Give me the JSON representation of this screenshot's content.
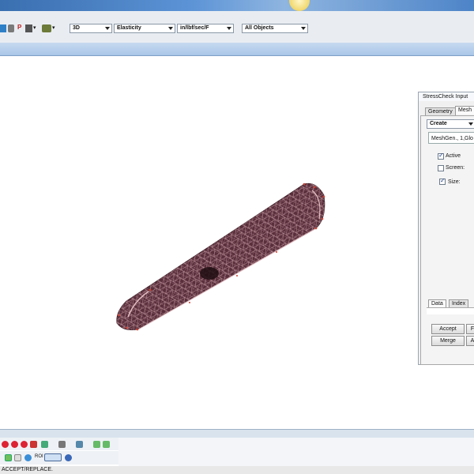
{
  "toolbar": {
    "p_label": "P",
    "mode_value": "3D",
    "analysis_value": "Elasticity",
    "units_value": "in/lbf/sec/F",
    "objects_value": "All Objects"
  },
  "panel": {
    "title": "StressCheck Input",
    "tabs": [
      "Geometry",
      "Mesh"
    ],
    "action_value": "Create",
    "list_value": "MeshGen., 1,Glo",
    "options": [
      {
        "label": "Active",
        "checked": true
      },
      {
        "label": "Screen:",
        "checked": false
      },
      {
        "label": "Size:",
        "checked": true
      }
    ],
    "bottom_tabs": [
      "Data",
      "Index"
    ],
    "buttons": {
      "accept": "Accept",
      "merge": "Merge",
      "f_partial": "F",
      "a_partial": "A"
    }
  },
  "status": {
    "text": "ACCEPT/REPLACE."
  },
  "bottom_toolbar": {
    "label_small": "ROI"
  },
  "colors": {
    "mesh_fill": "#5a2f3c",
    "mesh_line": "#c9a0a8",
    "accent_blue": "#a9c6e8",
    "highlight_button": "#6fbf5a"
  },
  "icons": [
    "select-icon",
    "pan-icon",
    "p-icon",
    "rotate-icon",
    "view-icon",
    "stop-icon",
    "no-entry-icon",
    "record-icon",
    "zoom-icon",
    "grid-icon",
    "mesh-icon",
    "globe-icon"
  ]
}
